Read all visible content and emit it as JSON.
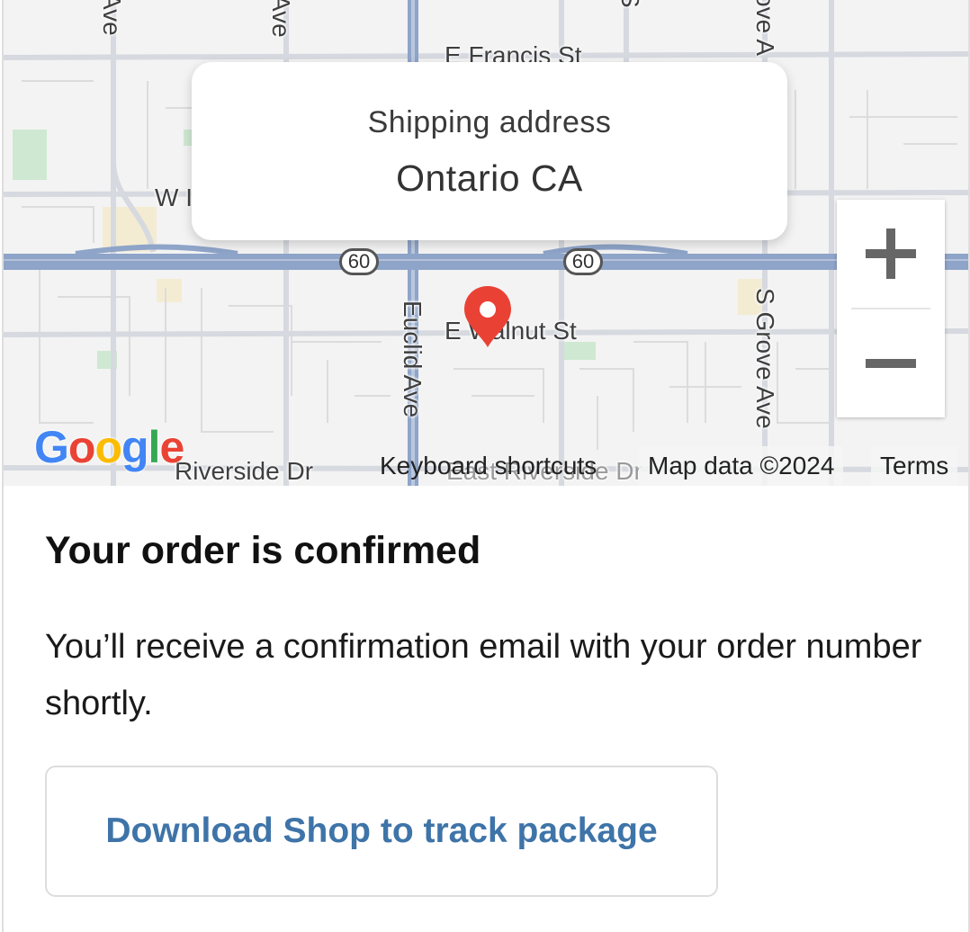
{
  "map": {
    "callout": {
      "label": "Shipping address",
      "value": "Ontario CA"
    },
    "streets": {
      "francis": "E Francis St",
      "walnut": "E Walnut St",
      "euclid": "Euclid Ave",
      "grove": "S Grove Ave",
      "riverside": "Riverside Dr",
      "east_riverside": "East Riverside Dr",
      "w_partial": "W I",
      "ave_1": "Ave",
      "ave_2": "Ave",
      "s_partial": "S",
      "grove_top": "ove A"
    },
    "highway": {
      "shield_1": "60",
      "shield_2": "60"
    },
    "zoom": {
      "in_label": "+",
      "out_label": "−"
    },
    "logo": {
      "g": "G",
      "o1": "o",
      "o2": "o",
      "g2": "g",
      "l": "l",
      "e": "e"
    },
    "attribution": {
      "keyboard_shortcuts": "Keyboard shortcuts",
      "map_data": "Map data ©2024",
      "terms": "Terms"
    },
    "colors": {
      "pin": "#e94235",
      "highway": "#8ea4c8",
      "road": "#d7dbe2"
    }
  },
  "order": {
    "title": "Your order is confirmed",
    "message": "You’ll receive a confirmation email with your order number shortly.",
    "cta_label": "Download Shop to track package"
  }
}
